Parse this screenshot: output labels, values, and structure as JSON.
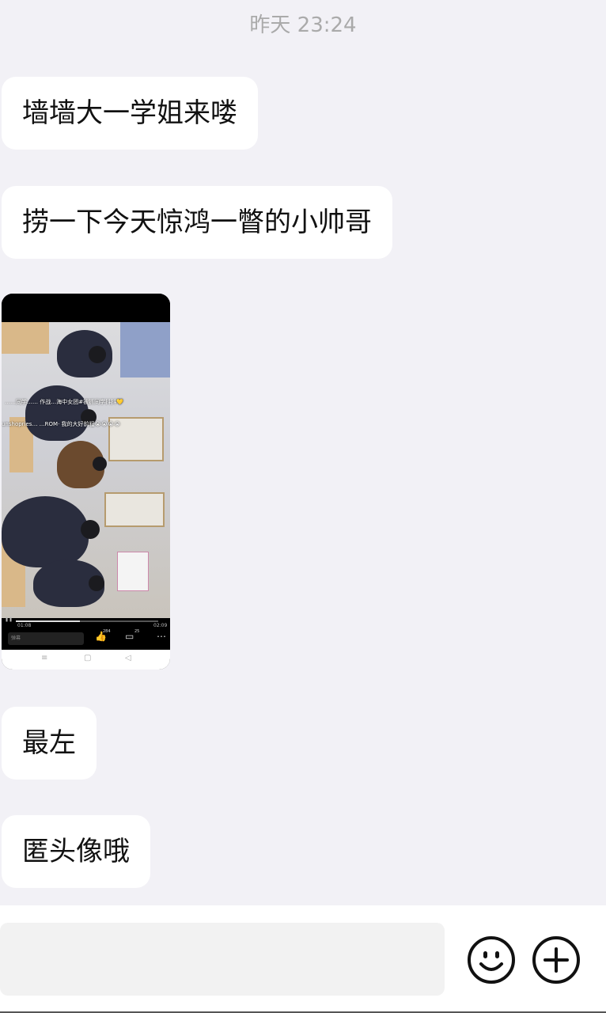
{
  "timestamp": "昨天 23:24",
  "messages": [
    {
      "text": "墙墙大一学姐来喽"
    },
    {
      "text": "捞一下今天惊鸿一瞥的小帅哥"
    },
    {
      "text": "最左"
    },
    {
      "text": "匿头像哦"
    }
  ],
  "video": {
    "caption_line1": "……同学……  作战…海中女团#被抓同学抖抖💛",
    "caption_line2": "unshopries…   …ROM·  我的大好前程😭😭😭😭",
    "time_elapsed": "01:08",
    "time_total": "02:09",
    "progress": 0.45,
    "comment_placeholder": "弹幕",
    "like_count": "284",
    "comment_count": "25"
  },
  "input": {
    "placeholder": ""
  },
  "icons": {
    "emoji": "smiley-face-icon",
    "plus": "plus-circle-icon"
  },
  "colors": {
    "background": "#f2f1f6",
    "bubble": "#ffffff",
    "timestamp": "#aaaaaa"
  }
}
